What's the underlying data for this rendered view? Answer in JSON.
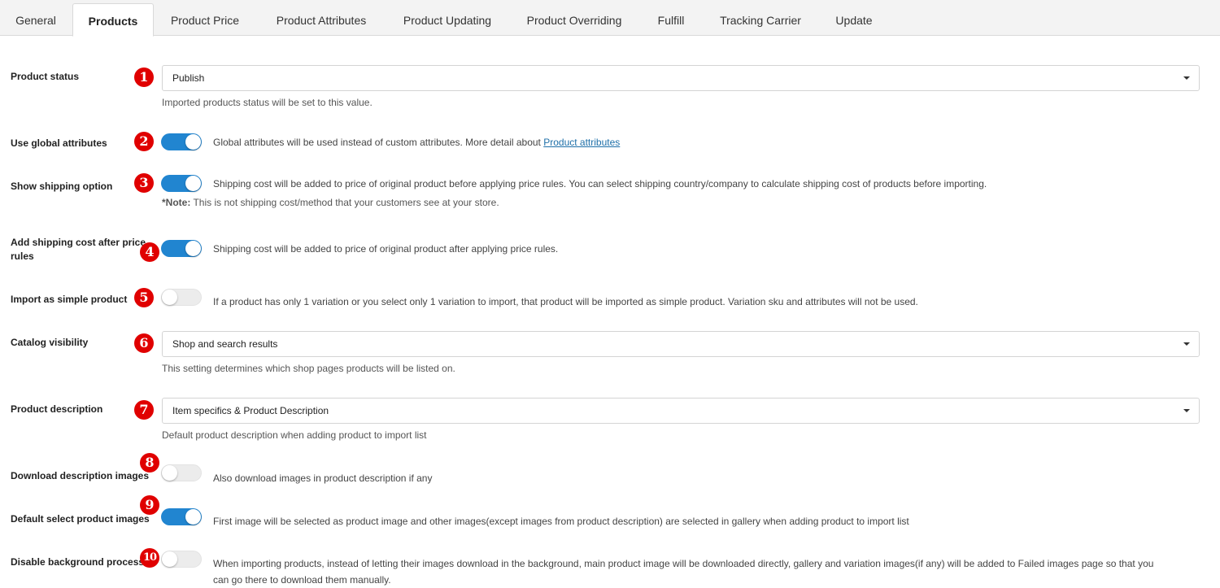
{
  "tabs": [
    {
      "label": "General",
      "active": false
    },
    {
      "label": "Products",
      "active": true
    },
    {
      "label": "Product Price",
      "active": false
    },
    {
      "label": "Product Attributes",
      "active": false
    },
    {
      "label": "Product Updating",
      "active": false
    },
    {
      "label": "Product Overriding",
      "active": false
    },
    {
      "label": "Fulfill",
      "active": false
    },
    {
      "label": "Tracking Carrier",
      "active": false
    },
    {
      "label": "Update",
      "active": false
    }
  ],
  "colors": {
    "accent": "#2185d0",
    "badge": "#e00000",
    "link": "#1e6fa8"
  },
  "settings": {
    "product_status": {
      "badge": "1",
      "label": "Product status",
      "value": "Publish",
      "help": "Imported products status will be set to this value."
    },
    "use_global_attributes": {
      "badge": "2",
      "label": "Use global attributes",
      "enabled": true,
      "desc": "Global attributes will be used instead of custom attributes. More detail about",
      "link": "Product attributes"
    },
    "show_shipping_option": {
      "badge": "3",
      "label": "Show shipping option",
      "enabled": true,
      "desc": "Shipping cost will be added to price of original product before applying price rules. You can select shipping country/company to calculate shipping cost of products before importing.",
      "note_label": "*Note:",
      "note": "This is not shipping cost/method that your customers see at your store."
    },
    "add_shipping_after_rules": {
      "badge": "4",
      "label_line1": "Add shipping cost after price",
      "label_line2": "rules",
      "enabled": true,
      "desc": "Shipping cost will be added to price of original product after applying price rules."
    },
    "import_as_simple": {
      "badge": "5",
      "label": "Import as simple product",
      "enabled": false,
      "desc": "If a product has only 1 variation or you select only 1 variation to import, that product will be imported as simple product. Variation sku and attributes will not be used."
    },
    "catalog_visibility": {
      "badge": "6",
      "label": "Catalog visibility",
      "value": "Shop and search results",
      "help": "This setting determines which shop pages products will be listed on."
    },
    "product_description": {
      "badge": "7",
      "label": "Product description",
      "value": "Item specifics & Product Description",
      "help": "Default product description when adding product to import list"
    },
    "download_desc_images": {
      "badge": "8",
      "label": "Download description images",
      "enabled": false,
      "desc": "Also download images in product description if any"
    },
    "default_select_images": {
      "badge": "9",
      "label": "Default select product images",
      "enabled": true,
      "desc": "First image will be selected as product image and other images(except images from product description) are selected in gallery when adding product to import list"
    },
    "disable_background_process": {
      "badge": "10",
      "label": "Disable background process",
      "enabled": false,
      "desc_line1": "When importing products, instead of letting their images download in the background, main product image will be downloaded directly, gallery and variation images(if any) will be added to Failed images page so that you",
      "desc_line2": "can go there to download them manually."
    }
  }
}
